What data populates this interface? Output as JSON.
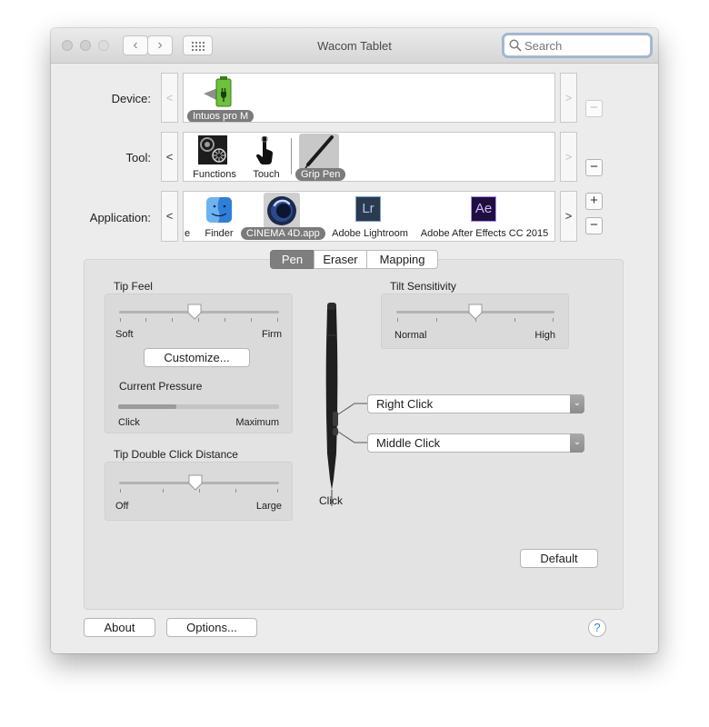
{
  "window": {
    "title": "Wacom Tablet"
  },
  "toolbar": {
    "back": "‹",
    "forward": "›",
    "grid_icon": "grid-icon",
    "search_placeholder": "Search"
  },
  "device": {
    "label": "Device:",
    "prev": "<",
    "next": ">",
    "items": [
      {
        "name": "Intuos pro M",
        "icon": "tablet-battery-icon",
        "selected": true
      }
    ],
    "remove": "−"
  },
  "tool": {
    "label": "Tool:",
    "prev": "<",
    "next": ">",
    "items": [
      {
        "name": "Functions",
        "icon": "functions-icon",
        "selected": false
      },
      {
        "name": "Touch",
        "icon": "touch-hand-icon",
        "selected": false
      },
      {
        "name": "Grip Pen",
        "icon": "grip-pen-icon",
        "selected": true
      }
    ],
    "remove": "−"
  },
  "application": {
    "label": "Application:",
    "prev": "<",
    "next": ">",
    "items": [
      {
        "name": "e",
        "icon": ""
      },
      {
        "name": "Finder",
        "icon": "finder-icon",
        "selected": false
      },
      {
        "name": "CINEMA 4D.app",
        "icon": "cinema4d-icon",
        "selected": true
      },
      {
        "name": "Adobe Lightroom",
        "icon": "lightroom-icon",
        "badge": "Lr",
        "selected": false
      },
      {
        "name": "Adobe After Effects CC 2015",
        "icon": "after-effects-icon",
        "badge": "Ae",
        "selected": false
      }
    ],
    "add": "+",
    "remove": "−"
  },
  "tabs": [
    {
      "label": "Pen",
      "selected": true
    },
    {
      "label": "Eraser",
      "selected": false
    },
    {
      "label": "Mapping",
      "selected": false
    }
  ],
  "tip_feel": {
    "title": "Tip Feel",
    "min_label": "Soft",
    "max_label": "Firm",
    "value": 0.47,
    "customize": "Customize...",
    "pressure_title": "Current Pressure",
    "pressure_min": "Click",
    "pressure_max": "Maximum",
    "pressure_value": 0.36
  },
  "tip_double_click": {
    "title": "Tip Double Click Distance",
    "min_label": "Off",
    "max_label": "Large",
    "value": 0.48
  },
  "tilt": {
    "title": "Tilt Sensitivity",
    "min_label": "Normal",
    "max_label": "High",
    "value": 0.5
  },
  "pen_buttons": {
    "upper": "Right Click",
    "lower": "Middle Click",
    "tip": "Click"
  },
  "buttons": {
    "default": "Default",
    "about": "About",
    "options": "Options...",
    "help": "?"
  }
}
